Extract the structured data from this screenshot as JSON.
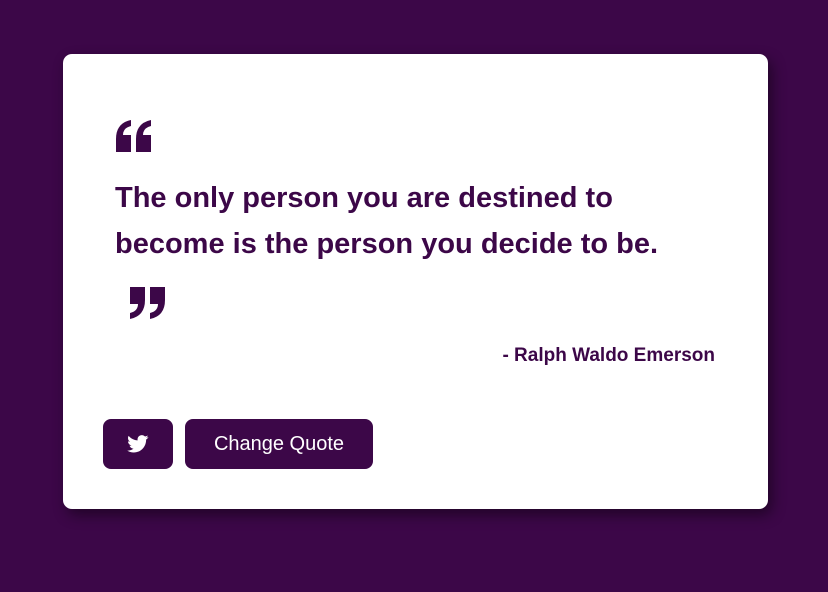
{
  "colors": {
    "background": "#3c0748",
    "card": "#ffffff",
    "accent": "#3c0748",
    "button_text": "#ffffff"
  },
  "icons": {
    "open_quote": "quote-left-icon",
    "close_quote": "quote-right-icon",
    "tweet": "twitter-icon"
  },
  "quote": {
    "text": "The only person you are destined to become is the person you decide to be.",
    "author": "- Ralph Waldo Emerson"
  },
  "actions": {
    "change_quote_label": "Change Quote"
  }
}
